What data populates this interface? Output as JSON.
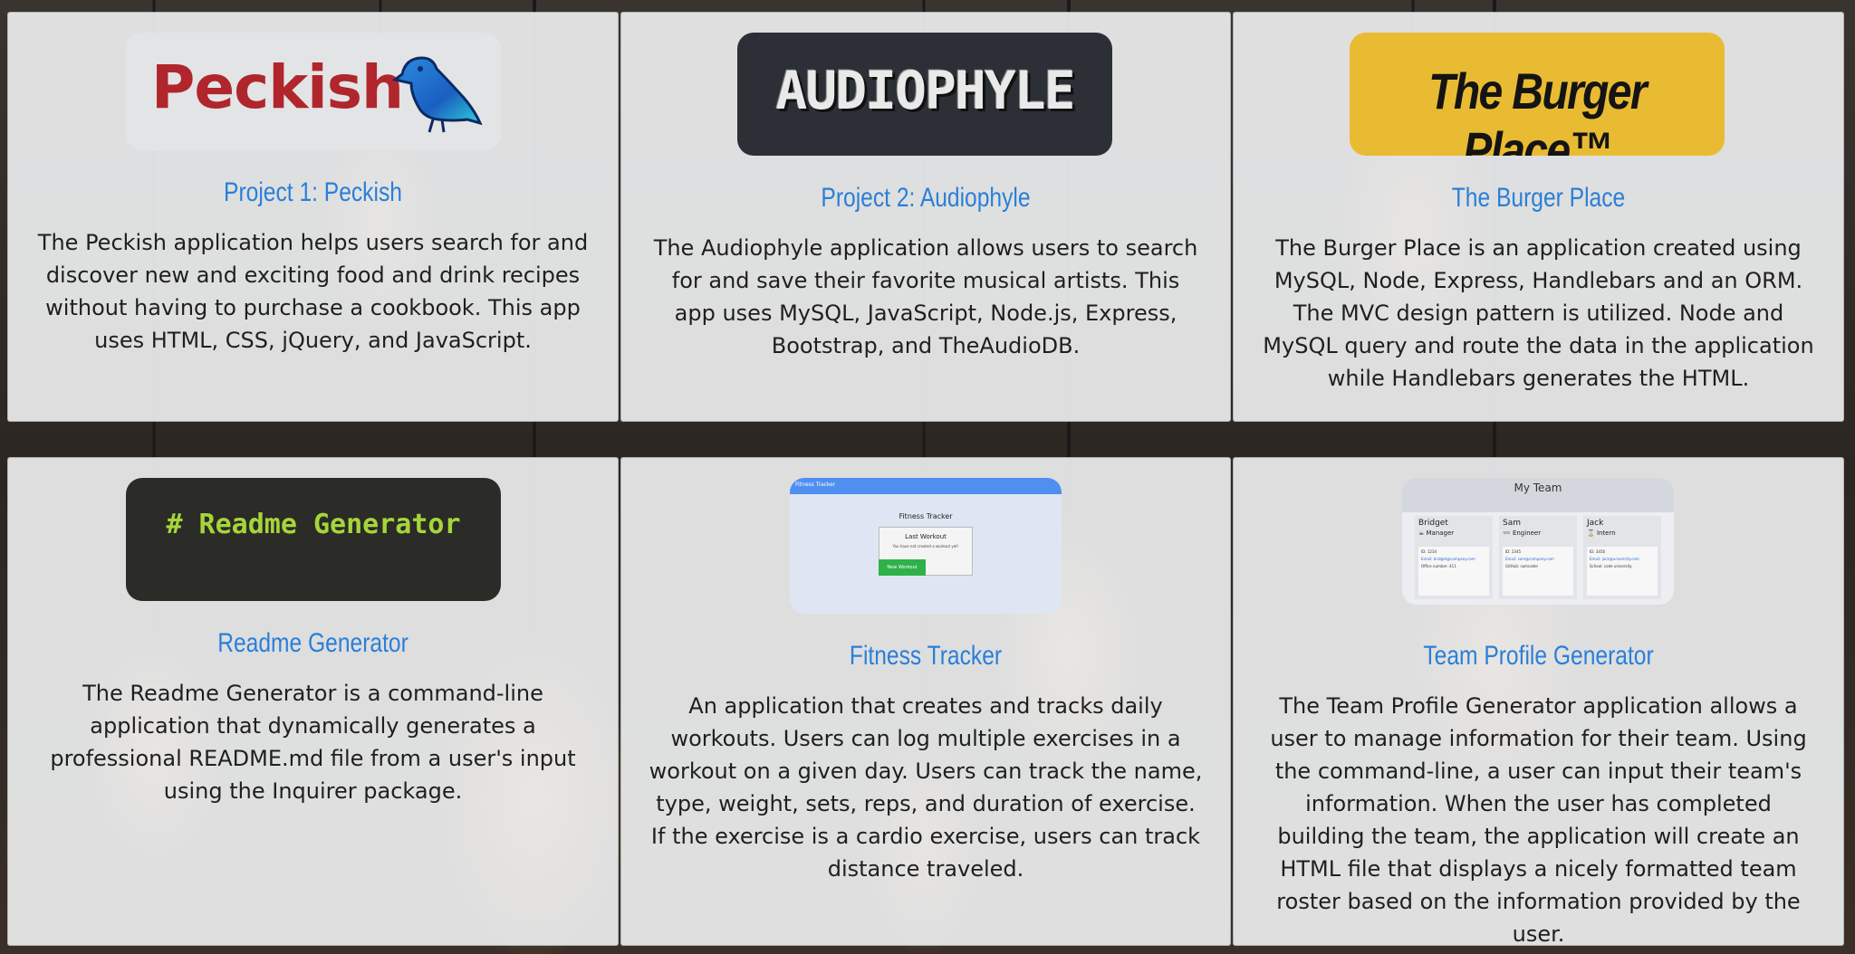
{
  "projects": [
    {
      "title": "Project 1: Peckish",
      "logo_text": "Peckish",
      "description": "The Peckish application helps users search for and discover new and exciting food and drink recipes without having to purchase a cookbook. This app uses HTML, CSS, jQuery, and JavaScript."
    },
    {
      "title": "Project 2: Audiophyle",
      "logo_text": "AUDIOPHYLE",
      "description": "The Audiophyle application allows users to search for and save their favorite musical artists. This app uses MySQL, JavaScript, Node.js, Express, Bootstrap, and TheAudioDB."
    },
    {
      "title": "The Burger Place",
      "logo_text": "The Burger Place™",
      "description": "The Burger Place is an application created using MySQL, Node, Express, Handlebars and an ORM. The MVC design pattern is utilized. Node and MySQL query and route the data in the application while Handlebars generates the HTML."
    },
    {
      "title": "Readme Generator",
      "logo_text": "# Readme Generator",
      "description": "The Readme Generator is a command-line application that dynamically generates a professional README.md file from a user's input using the Inquirer package."
    },
    {
      "title": "Fitness Tracker",
      "thumb": {
        "nav_text": "Fitness Tracker",
        "heading": "Fitness Tracker",
        "card_title": "Last Workout",
        "card_text": "You have not created a workout yet!",
        "button": "New Workout"
      },
      "description": "An application that creates and tracks daily workouts. Users can log multiple exercises in a workout on a given day. Users can track the name, type, weight, sets, reps, and duration of exercise. If the exercise is a cardio exercise, users can track distance traveled."
    },
    {
      "title": "Team Profile Generator",
      "thumb": {
        "header": "My Team",
        "members": [
          {
            "name": "Bridget",
            "role": "☕ Manager",
            "id": "ID: 1234",
            "email": "Email: bridget@company.com",
            "extra": "Office number: 411"
          },
          {
            "name": "Sam",
            "role": "👓 Engineer",
            "id": "ID: 2345",
            "email": "Email: sam@company.com",
            "extra": "GitHub: samcoder"
          },
          {
            "name": "Jack",
            "role": "⌛ Intern",
            "id": "ID: 3456",
            "email": "Email: jack@university.com",
            "extra": "School: code university"
          }
        ]
      },
      "description": "The Team Profile Generator application allows a user to manage information for their team. Using the command-line, a user can input their team's information. When the user has completed building the team, the application will create an HTML file that displays a nicely formatted team roster based on the information provided by the user."
    }
  ],
  "colors": {
    "title": "#2a7fd8",
    "card_bg": "#f0f1f2",
    "burger_yellow": "#e8bb32",
    "readme_green": "#a6d53a",
    "peckish_red": "#b0262c"
  }
}
